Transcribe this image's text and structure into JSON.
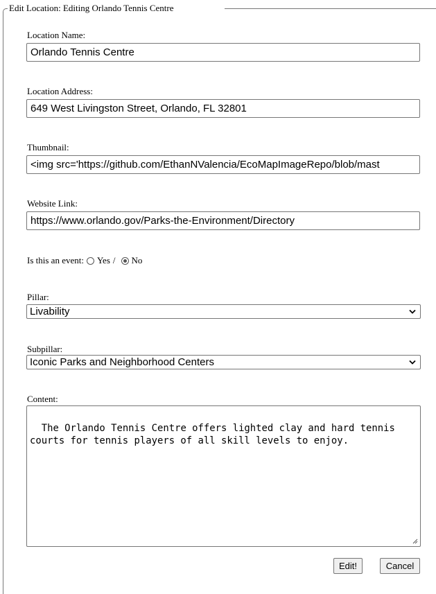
{
  "form": {
    "legend": "Edit Location: Editing Orlando Tennis Centre",
    "location_name": {
      "label": "Location Name:",
      "value": "Orlando Tennis Centre"
    },
    "location_address": {
      "label": "Location Address:",
      "value": "649 West Livingston Street, Orlando, FL 32801"
    },
    "thumbnail": {
      "label": "Thumbnail:",
      "value": "<img src='https://github.com/EthanNValencia/EcoMapImageRepo/blob/mast"
    },
    "website_link": {
      "label": "Website Link:",
      "value": "https://www.orlando.gov/Parks-the-Environment/Directory"
    },
    "is_event": {
      "label": "Is this an event:",
      "yes_label": "Yes",
      "separator": "/",
      "no_label": "No",
      "selected": "No"
    },
    "pillar": {
      "label": "Pillar:",
      "value": "Livability"
    },
    "subpillar": {
      "label": "Subpillar:",
      "value": "Iconic Parks and Neighborhood Centers"
    },
    "content": {
      "label": "Content:",
      "value": "The Orlando Tennis Centre offers lighted clay and hard tennis\ncourts for tennis players of all skill levels to enjoy."
    },
    "buttons": {
      "edit": "Edit!",
      "cancel": "Cancel"
    }
  }
}
